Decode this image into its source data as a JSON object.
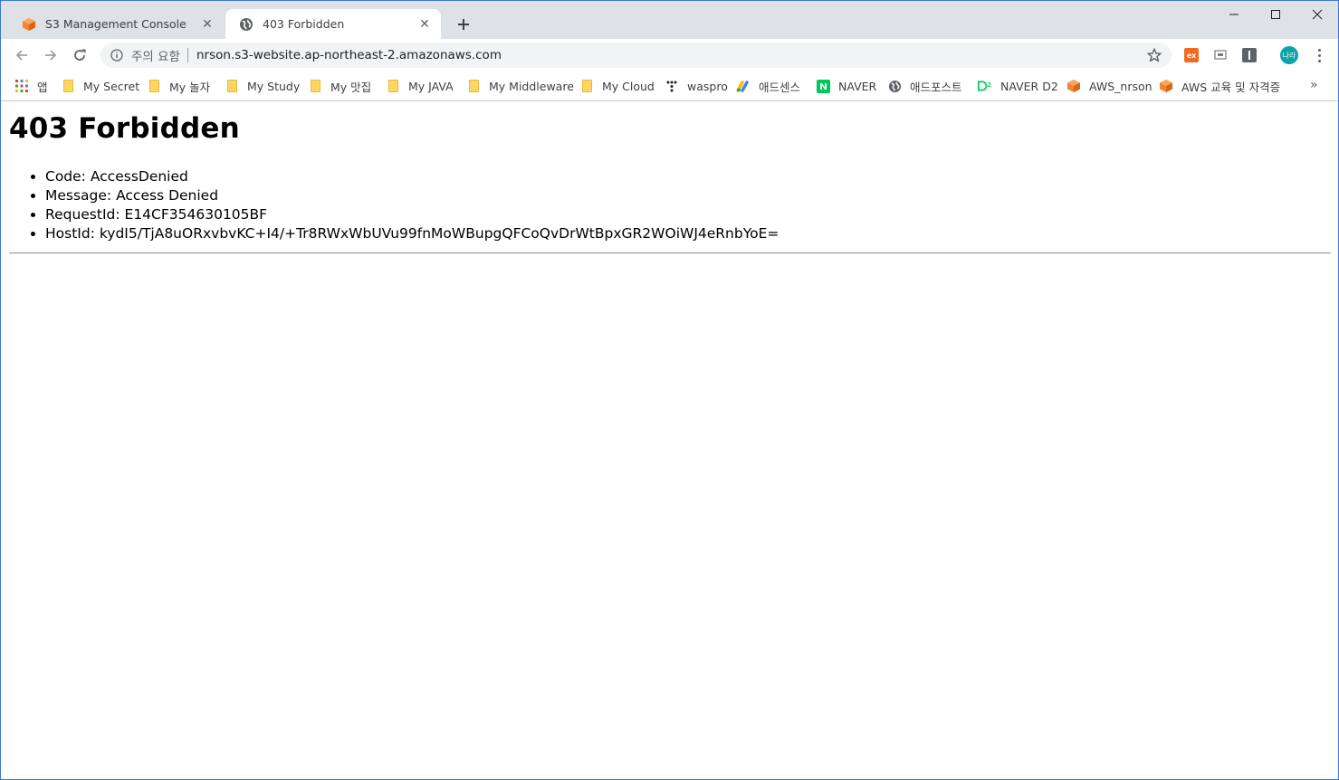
{
  "tabs": [
    {
      "title": "S3 Management Console",
      "icon": "aws-cube-icon",
      "active": false
    },
    {
      "title": "403 Forbidden",
      "icon": "globe-icon",
      "active": true
    }
  ],
  "toolbar": {
    "security_label": "주의 요함",
    "url": "nrson.s3-website.ap-northeast-2.amazonaws.com",
    "profile_initials": "나라",
    "ext_label": "ex"
  },
  "bookmarks": {
    "apps_label": "앱",
    "items": [
      {
        "label": "My Secret",
        "icon": "folder-icon"
      },
      {
        "label": "My 놀자",
        "icon": "folder-icon"
      },
      {
        "label": "My Study",
        "icon": "folder-icon"
      },
      {
        "label": "My 맛집",
        "icon": "folder-icon"
      },
      {
        "label": "My JAVA",
        "icon": "folder-icon"
      },
      {
        "label": "My Middleware",
        "icon": "folder-icon"
      },
      {
        "label": "My Cloud",
        "icon": "folder-icon"
      },
      {
        "label": "waspro",
        "icon": "dots-icon"
      },
      {
        "label": "애드센스",
        "icon": "adsense-icon"
      },
      {
        "label": "NAVER",
        "icon": "naver-icon"
      },
      {
        "label": "애드포스트",
        "icon": "globe-icon"
      },
      {
        "label": "NAVER D2",
        "icon": "d2-icon"
      },
      {
        "label": "AWS_nrson",
        "icon": "aws-cube-icon"
      },
      {
        "label": "AWS 교육 및 자격증",
        "icon": "aws-cube-icon"
      }
    ],
    "more": "»"
  },
  "page": {
    "heading": "403 Forbidden",
    "details": [
      "Code: AccessDenied",
      "Message: Access Denied",
      "RequestId: E14CF354630105BF",
      "HostId: kydI5/TjA8uORxvbvKC+I4/+Tr8RWxWbUVu99fnMoWBupgQFCoQvDrWtBpxGR2WOiWJ4eRnbYoE="
    ]
  }
}
